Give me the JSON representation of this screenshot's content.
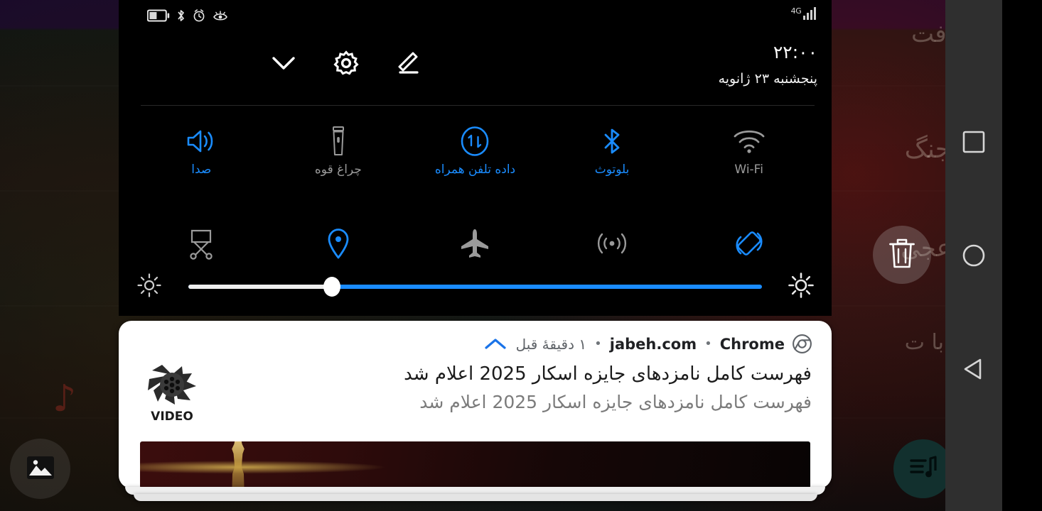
{
  "statusbar": {
    "icons": [
      {
        "name": "battery-icon",
        "label": "battery"
      },
      {
        "name": "bluetooth-icon",
        "label": "bluetooth"
      },
      {
        "name": "alarm-icon",
        "label": "alarm"
      },
      {
        "name": "eye-comfort-icon",
        "label": "eye comfort"
      }
    ],
    "network_label": "4G",
    "signal_bars": 4
  },
  "shade": {
    "header_icons": [
      {
        "name": "chevron-down-icon",
        "label": "collapse"
      },
      {
        "name": "gear-icon",
        "label": "settings"
      },
      {
        "name": "edit-icon",
        "label": "edit"
      }
    ],
    "time": "۲۲:۰۰",
    "date": "پنجشنبه ۲۳ ژانویه",
    "tiles_row1": [
      {
        "name": "sound",
        "label": "صدا",
        "icon": "volume-icon",
        "state": "on"
      },
      {
        "name": "flashlight",
        "label": "چراغ قوه",
        "icon": "flashlight-icon",
        "state": "off"
      },
      {
        "name": "mobile-data",
        "label": "داده تلفن همراه",
        "icon": "mobile-data-icon",
        "state": "on"
      },
      {
        "name": "bluetooth",
        "label": "بلوتوث",
        "icon": "bluetooth-icon",
        "state": "on"
      },
      {
        "name": "wifi",
        "label": "Wi-Fi",
        "icon": "wifi-icon",
        "state": "off"
      }
    ],
    "tiles_row2": [
      {
        "name": "screenshot",
        "label": "",
        "icon": "screenshot-scissors-icon",
        "state": "off"
      },
      {
        "name": "location",
        "label": "",
        "icon": "location-pin-icon",
        "state": "on"
      },
      {
        "name": "airplane",
        "label": "",
        "icon": "airplane-icon",
        "state": "off"
      },
      {
        "name": "hotspot",
        "label": "",
        "icon": "hotspot-icon",
        "state": "off"
      },
      {
        "name": "auto-rotate",
        "label": "",
        "icon": "auto-rotate-icon",
        "state": "on"
      }
    ],
    "brightness": {
      "low_icon": "brightness-low-icon",
      "high_icon": "brightness-high-icon",
      "value_percent": 25
    }
  },
  "notification": {
    "app": "Chrome",
    "source": "jabeh.com",
    "time": "۱ دقیقهٔ قبل",
    "separator": "•",
    "title": "فهرست کامل نامزدهای جایزه اسکار 2025 اعلام شد",
    "body": "فهرست کامل نامزدهای جایزه اسکار 2025 اعلام شد",
    "app_logo_text": "VIDEO"
  },
  "navbar": {
    "buttons": [
      {
        "name": "recents-button",
        "icon": "square-icon"
      },
      {
        "name": "home-button",
        "icon": "circle-icon"
      },
      {
        "name": "back-button",
        "icon": "triangle-left-icon"
      }
    ]
  },
  "floating": [
    {
      "name": "gallery-button",
      "icon": "image-icon"
    },
    {
      "name": "delete-button",
      "icon": "trash-icon"
    },
    {
      "name": "music-button",
      "icon": "playlist-music-icon"
    }
  ],
  "wallpaper": {
    "texts": [
      "جنگ",
      "رفت",
      "عجی",
      "با ت"
    ],
    "accent_red": "#be3028",
    "accent_blue": "#1a8cff"
  }
}
